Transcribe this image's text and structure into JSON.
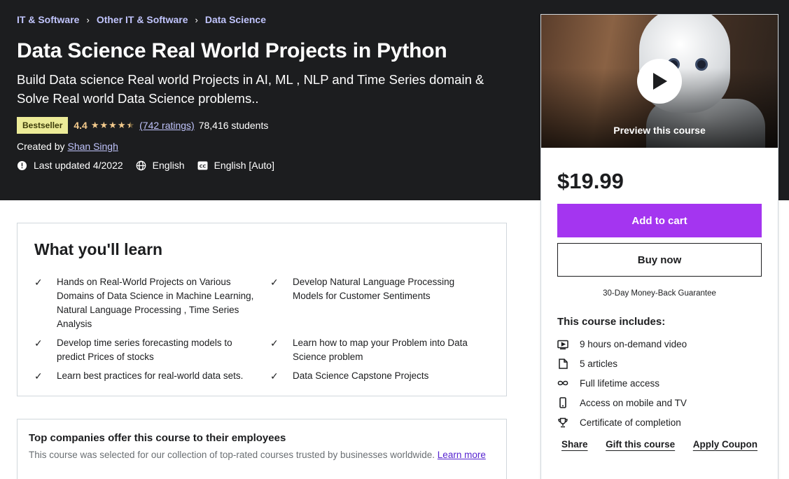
{
  "breadcrumb": [
    "IT & Software",
    "Other IT & Software",
    "Data Science"
  ],
  "course": {
    "title": "Data Science Real World Projects in Python",
    "subtitle": "Build Data science Real world Projects in AI, ML , NLP and Time Series domain & Solve Real world Data Science problems..",
    "badge": "Bestseller",
    "rating": "4.4",
    "rating_value": 4.4,
    "ratings_count": "(742 ratings)",
    "students": "78,416 students",
    "created_by_label": "Created by",
    "author": "Shan Singh",
    "last_updated": "Last updated 4/2022",
    "language": "English",
    "captions": "English [Auto]"
  },
  "sidebar": {
    "preview_label": "Preview this course",
    "price": "$19.99",
    "add_to_cart": "Add to cart",
    "buy_now": "Buy now",
    "guarantee": "30-Day Money-Back Guarantee",
    "includes_title": "This course includes:",
    "includes": [
      {
        "icon": "video-icon",
        "text": "9 hours on-demand video"
      },
      {
        "icon": "file-icon",
        "text": "5 articles"
      },
      {
        "icon": "infinity-icon",
        "text": "Full lifetime access"
      },
      {
        "icon": "mobile-icon",
        "text": "Access on mobile and TV"
      },
      {
        "icon": "trophy-icon",
        "text": "Certificate of completion"
      }
    ],
    "share": "Share",
    "gift": "Gift this course",
    "coupon": "Apply Coupon"
  },
  "learn": {
    "title": "What you'll learn",
    "items": [
      "Hands on Real-World Projects on Various Domains of Data Science in Machine Learning, Natural Language Processing , Time Series Analysis",
      "Develop Natural Language Processing Models for Customer Sentiments",
      "Develop time series forecasting models to predict Prices of stocks",
      "Learn how to map your Problem into Data Science problem",
      "Learn best practices for real-world data sets.",
      "Data Science Capstone Projects"
    ]
  },
  "companies": {
    "title": "Top companies offer this course to their employees",
    "text": "This course was selected for our collection of top-rated courses trusted by businesses worldwide.",
    "link": "Learn more"
  },
  "colors": {
    "hero_bg": "#1c1d1f",
    "accent_purple": "#a435f0",
    "link_light": "#c0c4fc",
    "star": "#f3ca8c",
    "badge_bg": "#eceb98"
  }
}
